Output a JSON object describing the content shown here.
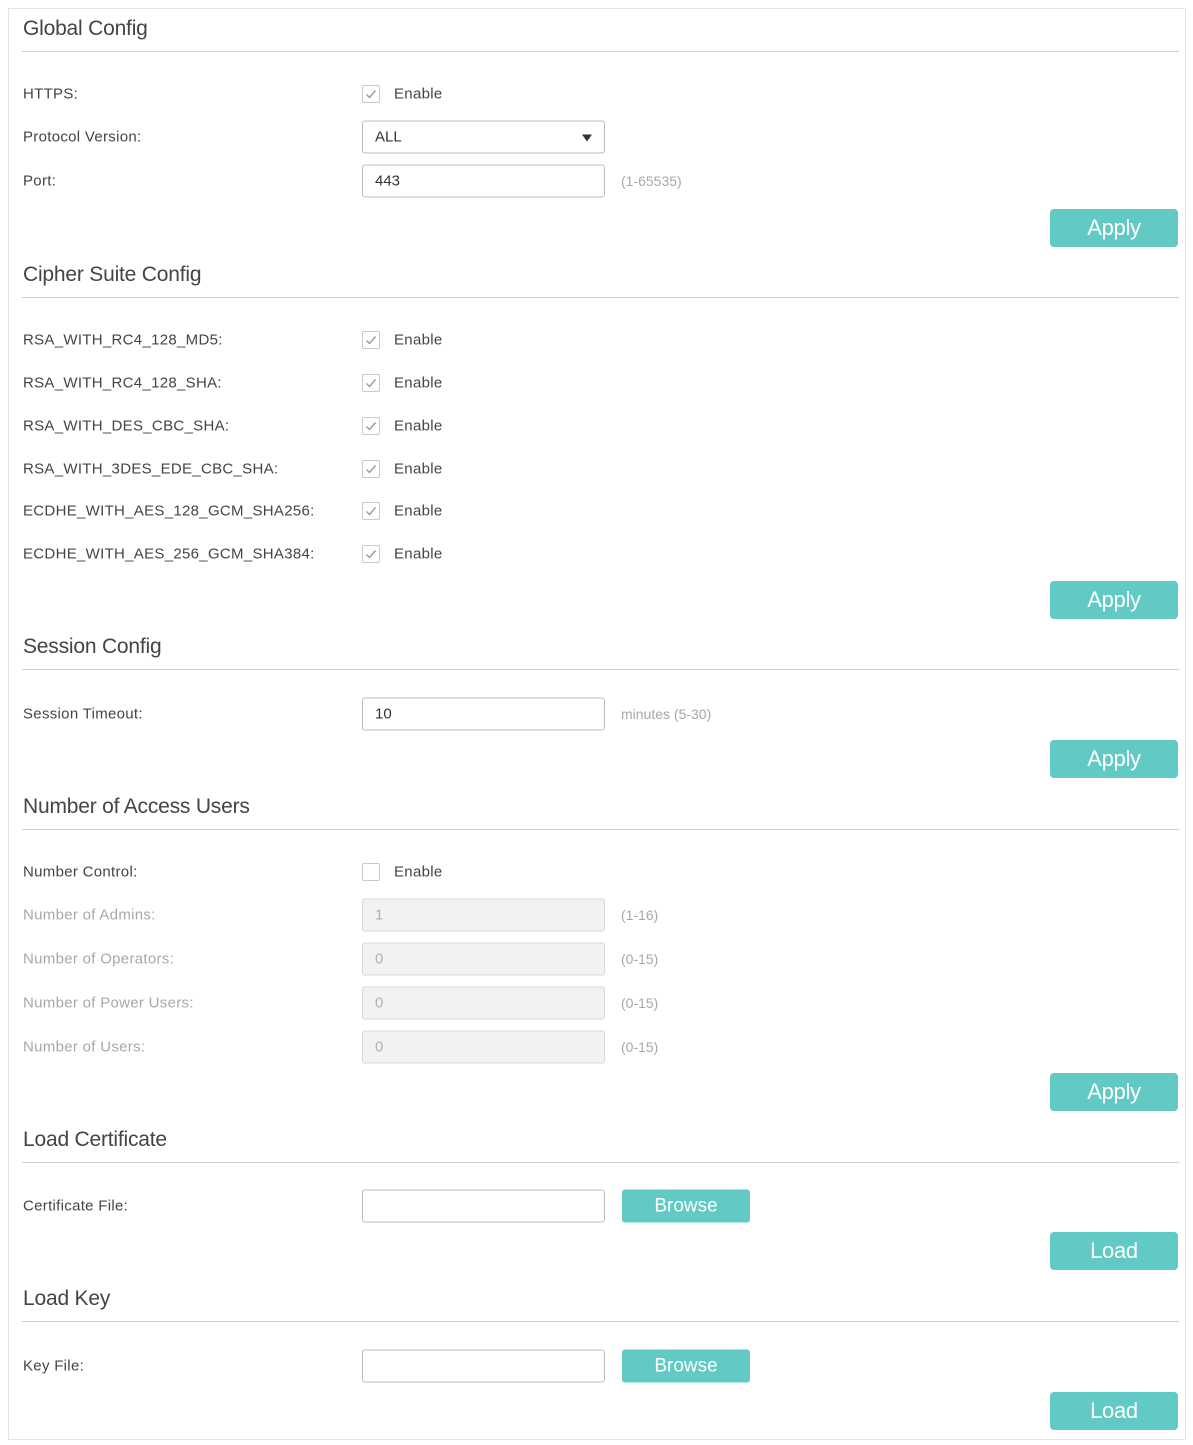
{
  "colors": {
    "accent": "#62cac4",
    "text": "#444444",
    "muted": "#a8a8a8",
    "disabled_bg": "#f2f2f2"
  },
  "global": {
    "title": "Global Config",
    "https_label": "HTTPS:",
    "https_enabled": true,
    "enable_text": "Enable",
    "protocol_label": "Protocol Version:",
    "protocol_value": "ALL",
    "port_label": "Port:",
    "port_value": "443",
    "port_hint": "(1-65535)",
    "apply": "Apply"
  },
  "cipher": {
    "title": "Cipher Suite Config",
    "suites": [
      {
        "name": "RSA_WITH_RC4_128_MD5:",
        "enabled": true,
        "enable_text": "Enable"
      },
      {
        "name": "RSA_WITH_RC4_128_SHA:",
        "enabled": true,
        "enable_text": "Enable"
      },
      {
        "name": "RSA_WITH_DES_CBC_SHA:",
        "enabled": true,
        "enable_text": "Enable"
      },
      {
        "name": "RSA_WITH_3DES_EDE_CBC_SHA:",
        "enabled": true,
        "enable_text": "Enable"
      },
      {
        "name": "ECDHE_WITH_AES_128_GCM_SHA256:",
        "enabled": true,
        "enable_text": "Enable"
      },
      {
        "name": "ECDHE_WITH_AES_256_GCM_SHA384:",
        "enabled": true,
        "enable_text": "Enable"
      }
    ],
    "apply": "Apply"
  },
  "session": {
    "title": "Session Config",
    "timeout_label": "Session Timeout:",
    "timeout_value": "10",
    "timeout_hint": "minutes (5-30)",
    "apply": "Apply"
  },
  "access": {
    "title": "Number of Access Users",
    "control_label": "Number Control:",
    "control_enabled": false,
    "enable_text": "Enable",
    "fields": [
      {
        "label": "Number of Admins:",
        "value": "1",
        "hint": "(1-16)"
      },
      {
        "label": "Number of Operators:",
        "value": "0",
        "hint": "(0-15)"
      },
      {
        "label": "Number of Power Users:",
        "value": "0",
        "hint": "(0-15)"
      },
      {
        "label": "Number of Users:",
        "value": "0",
        "hint": "(0-15)"
      }
    ],
    "apply": "Apply"
  },
  "cert": {
    "title": "Load Certificate",
    "file_label": "Certificate File:",
    "file_value": "",
    "browse": "Browse",
    "load": "Load"
  },
  "key": {
    "title": "Load Key",
    "file_label": "Key File:",
    "file_value": "",
    "browse": "Browse",
    "load": "Load"
  }
}
